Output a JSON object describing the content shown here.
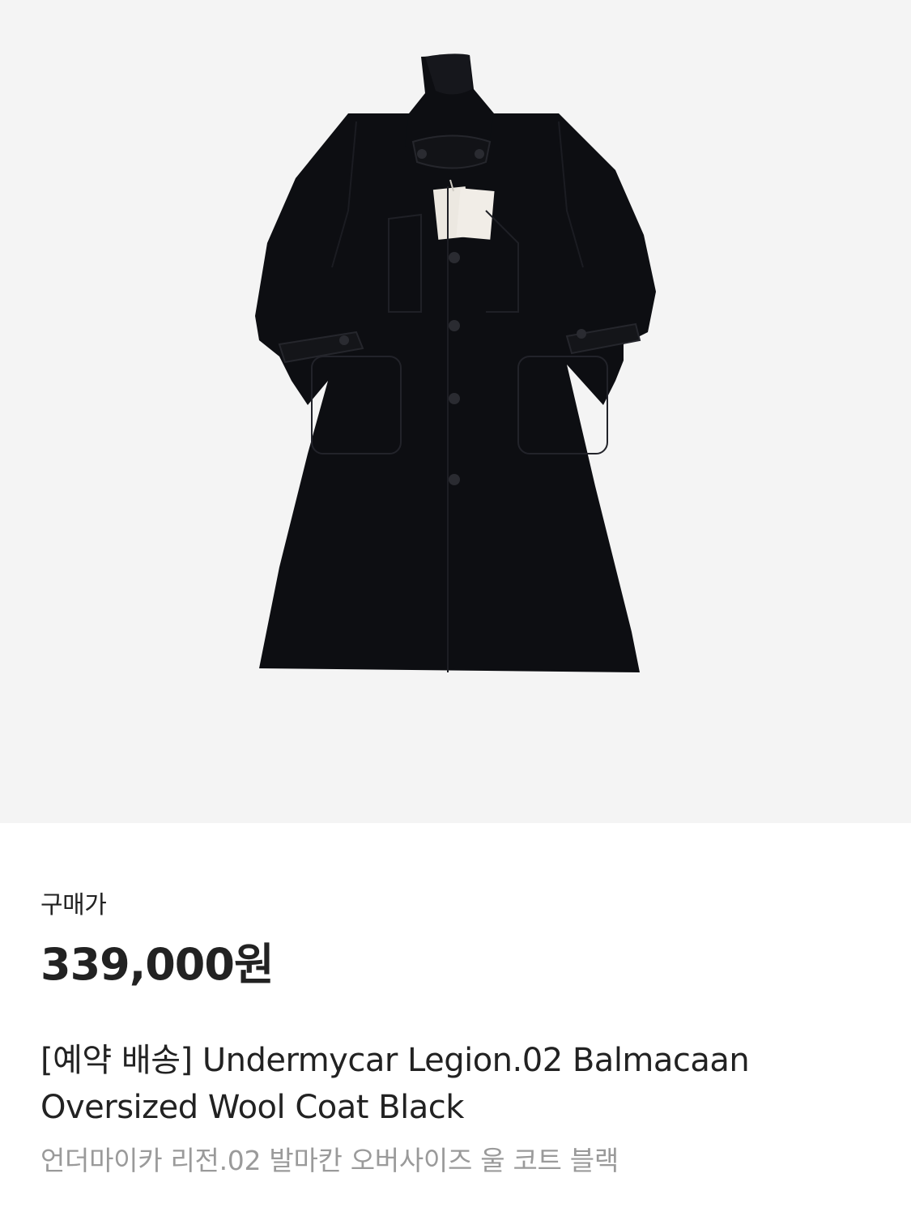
{
  "product": {
    "price_label": "구매가",
    "price": "339,000원",
    "title": "[예약 배송] Undermycar Legion.02 Balmacaan Oversized Wool Coat Black",
    "subtitle": "언더마이카 리전.02 발마칸 오버사이즈 울 코트 블랙"
  },
  "image": {
    "subject": "black-wool-coat",
    "background_color": "#f4f4f4",
    "coat_color": "#0d0e12"
  }
}
